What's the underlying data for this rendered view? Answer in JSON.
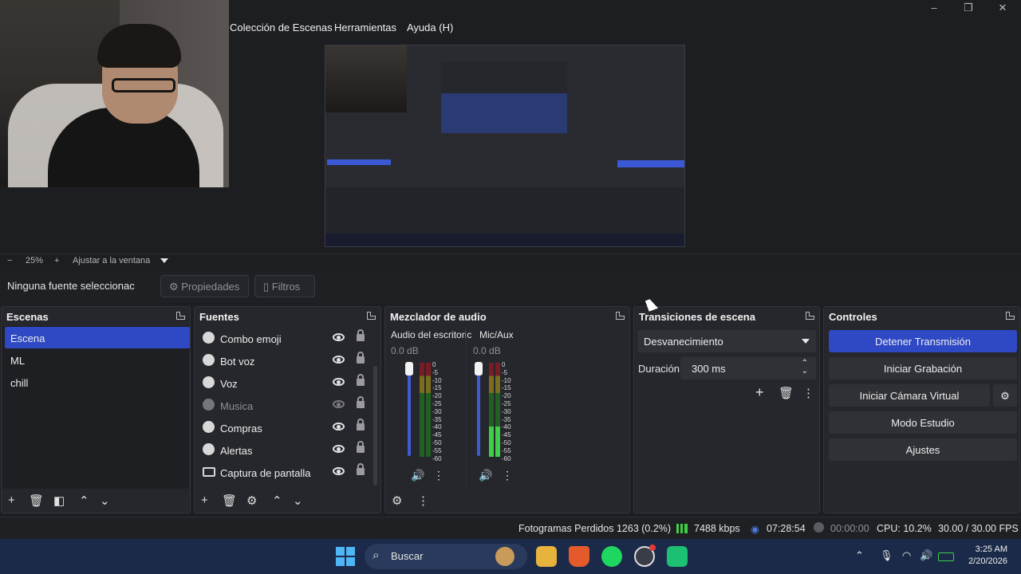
{
  "menu": {
    "items": [
      "Colección de Escenas",
      "Herramientas",
      "Ayuda (H)"
    ]
  },
  "zoom": {
    "minus": "−",
    "level": "25%",
    "plus": "+",
    "fit_label": "Ajustar a la ventana"
  },
  "source_toolbar": {
    "no_source": "Ninguna fuente seleccionac",
    "properties": "Propiedades",
    "filters": "Filtros"
  },
  "scenes": {
    "title": "Escenas",
    "items": [
      "Escena",
      "ML",
      "chill"
    ],
    "selected_index": 0
  },
  "sources": {
    "title": "Fuentes",
    "items": [
      {
        "label": "Combo emoji",
        "icon": "globe-icon",
        "visible": true
      },
      {
        "label": "Bot voz",
        "icon": "globe-icon",
        "visible": true
      },
      {
        "label": "Voz",
        "icon": "globe-icon",
        "visible": true
      },
      {
        "label": "Musica",
        "icon": "globe-icon",
        "visible": false
      },
      {
        "label": "Compras",
        "icon": "globe-icon",
        "visible": true
      },
      {
        "label": "Alertas",
        "icon": "globe-icon",
        "visible": true
      },
      {
        "label": "Captura de pantalla",
        "icon": "monitor-icon",
        "visible": true
      }
    ]
  },
  "mixer": {
    "title": "Mezclador de audio",
    "channels": [
      {
        "name": "Audio del escritoric",
        "db": "0.0 dB"
      },
      {
        "name": "Mic/Aux",
        "db": "0.0 dB"
      }
    ],
    "scale": [
      "0",
      "-5",
      "-10",
      "-15",
      "-20",
      "-25",
      "-30",
      "-35",
      "-40",
      "-45",
      "-50",
      "-55",
      "-60"
    ]
  },
  "transitions": {
    "title": "Transiciones de escena",
    "selected": "Desvanecimiento",
    "duration_label": "Duración",
    "duration_value": "300 ms"
  },
  "controls": {
    "title": "Controles",
    "stop_stream": "Detener Transmisión",
    "start_recording": "Iniciar Grabación",
    "start_virtual_cam": "Iniciar Cámara Virtual",
    "studio_mode": "Modo Estudio",
    "settings": "Ajustes"
  },
  "status": {
    "dropped_frames": "Fotogramas Perdidos 1263 (0.2%)",
    "bitrate": "7488 kbps",
    "stream_time": "07:28:54",
    "record_time": "00:00:00",
    "cpu": "CPU: 10.2%",
    "fps": "30.00 / 30.00 FPS"
  },
  "taskbar": {
    "search_label": "Buscar",
    "time": "3:25 AM",
    "date": "2/20/2026"
  },
  "colors": {
    "accent": "#2f49c5",
    "panel": "#26272c",
    "taskbar": "#1c2a4a"
  }
}
